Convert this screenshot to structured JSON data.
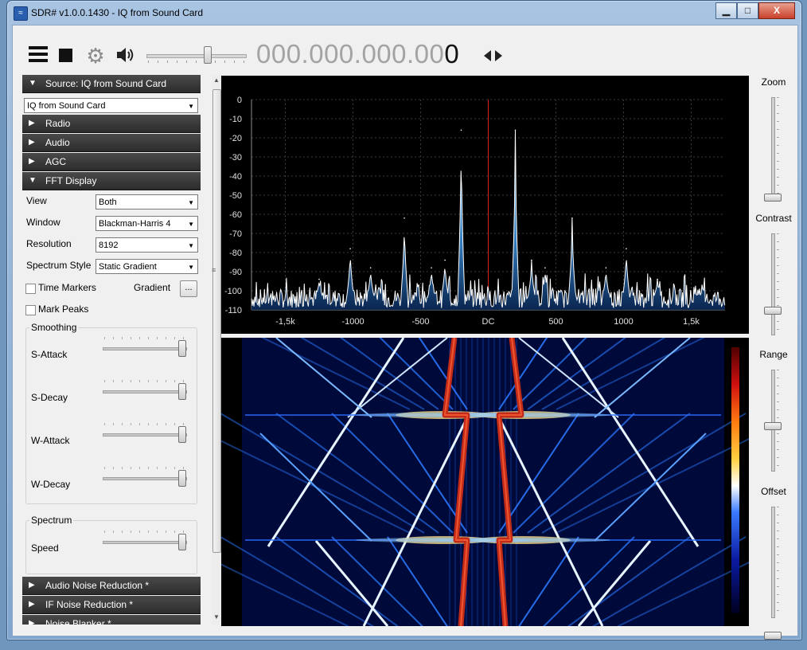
{
  "window": {
    "title": "SDR# v1.0.0.1430 - IQ from Sound Card",
    "minimize": "▁",
    "maximize": "□",
    "close": "X"
  },
  "toolbar": {
    "frequency_main": "000.000.000.00",
    "frequency_last": "0",
    "volume_level": 0.62
  },
  "panel": {
    "source": {
      "header": "Source: IQ from Sound Card",
      "device": "IQ from Sound Card",
      "expanded": true
    },
    "sections_collapsed": [
      "Radio",
      "Audio",
      "AGC"
    ],
    "fft": {
      "header": "FFT Display",
      "view_label": "View",
      "view_value": "Both",
      "window_label": "Window",
      "window_value": "Blackman-Harris 4",
      "resolution_label": "Resolution",
      "resolution_value": "8192",
      "style_label": "Spectrum Style",
      "style_value": "Static Gradient",
      "time_markers": "Time Markers",
      "gradient_label": "Gradient",
      "gradient_button": "...",
      "mark_peaks": "Mark Peaks",
      "smoothing_title": "Smoothing",
      "s_attack": "S-Attack",
      "s_decay": "S-Decay",
      "w_attack": "W-Attack",
      "w_decay": "W-Decay",
      "spectrum_title": "Spectrum",
      "speed": "Speed"
    },
    "bottom_sections": [
      "Audio Noise Reduction *",
      "IF Noise Reduction *",
      "Noise Blanker *"
    ]
  },
  "right_controls": {
    "zoom": "Zoom",
    "contrast": "Contrast",
    "range": "Range",
    "offset": "Offset"
  },
  "chart_data": {
    "type": "line",
    "title": "",
    "ylim": [
      -110,
      0
    ],
    "y_ticks": [
      "0",
      "-10",
      "-20",
      "-30",
      "-40",
      "-50",
      "-60",
      "-70",
      "-80",
      "-90",
      "-100",
      "-110"
    ],
    "x_ticks": [
      "-1,5k",
      "-1000",
      "-500",
      "DC",
      "500",
      "1000",
      "1,5k"
    ],
    "xlim": [
      -1750,
      1750
    ],
    "center_marker": 0,
    "series": [
      {
        "peaks_x": [
          -1020,
          -620,
          -200,
          200,
          620,
          1020,
          -870,
          -420,
          -320,
          320,
          420,
          870,
          -1250,
          1250
        ],
        "peaks_y": [
          -78,
          -62,
          -16,
          -16,
          -62,
          -78,
          -88,
          -88,
          -84,
          -84,
          -88,
          -88,
          -94,
          -94
        ]
      }
    ],
    "noise_floor": -103
  },
  "colors": {
    "panel_header": "#333333",
    "spectrum_line": "#ffffff",
    "spectrum_fill": "#3a8ed8",
    "center_marker": "#d42020",
    "waterfall_bg": "#000a3a"
  }
}
